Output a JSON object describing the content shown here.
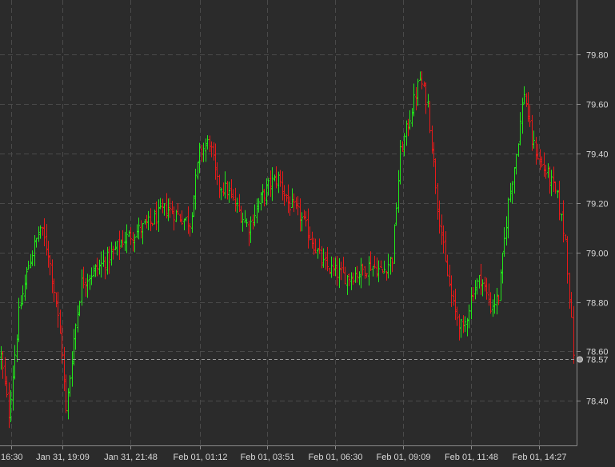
{
  "chart_data": {
    "type": "ohlc",
    "title": "",
    "xlabel": "",
    "ylabel": "",
    "ylim": [
      78.22,
      80.02
    ],
    "y_ticks": [
      78.4,
      78.6,
      78.8,
      79.0,
      79.2,
      79.4,
      79.6,
      79.8
    ],
    "y_tick_labels": [
      "78.40",
      "78.60",
      "78.80",
      "79.00",
      "79.20",
      "79.40",
      "79.60",
      "79.80"
    ],
    "x_tick_labels": [
      "16:30",
      "Jan 31, 19:09",
      "Jan 31, 21:48",
      "Feb 01, 01:12",
      "Feb 01, 03:51",
      "Feb 01, 06:30",
      "Feb 01, 09:09",
      "Feb 01, 11:48",
      "Feb 01, 14:27"
    ],
    "current_price": 78.57,
    "current_price_label": "78.57",
    "grid": true,
    "colors": {
      "background": "#2b2b2b",
      "up": "#22e81a",
      "down": "#e81a1a",
      "grid": "#4a4a4a",
      "axis_text": "#d8d8d8",
      "current_line": "#9a9a9a"
    },
    "series": [
      {
        "anchors": [
          {
            "i": 0,
            "v": 78.58
          },
          {
            "i": 4,
            "v": 78.35
          },
          {
            "i": 9,
            "v": 78.75
          },
          {
            "i": 14,
            "v": 78.95
          },
          {
            "i": 20,
            "v": 79.1
          },
          {
            "i": 24,
            "v": 79.0
          },
          {
            "i": 28,
            "v": 78.8
          },
          {
            "i": 31,
            "v": 78.6
          },
          {
            "i": 33,
            "v": 78.35
          },
          {
            "i": 37,
            "v": 78.65
          },
          {
            "i": 41,
            "v": 78.88
          },
          {
            "i": 48,
            "v": 78.93
          },
          {
            "i": 55,
            "v": 78.98
          },
          {
            "i": 62,
            "v": 79.05
          },
          {
            "i": 68,
            "v": 79.08
          },
          {
            "i": 76,
            "v": 79.12
          },
          {
            "i": 84,
            "v": 79.18
          },
          {
            "i": 90,
            "v": 79.15
          },
          {
            "i": 96,
            "v": 79.12
          },
          {
            "i": 101,
            "v": 79.4
          },
          {
            "i": 106,
            "v": 79.45
          },
          {
            "i": 110,
            "v": 79.28
          },
          {
            "i": 115,
            "v": 79.25
          },
          {
            "i": 120,
            "v": 79.18
          },
          {
            "i": 126,
            "v": 79.1
          },
          {
            "i": 131,
            "v": 79.2
          },
          {
            "i": 137,
            "v": 79.28
          },
          {
            "i": 141,
            "v": 79.3
          },
          {
            "i": 146,
            "v": 79.2
          },
          {
            "i": 152,
            "v": 79.15
          },
          {
            "i": 158,
            "v": 79.05
          },
          {
            "i": 164,
            "v": 78.95
          },
          {
            "i": 170,
            "v": 78.92
          },
          {
            "i": 176,
            "v": 78.9
          },
          {
            "i": 182,
            "v": 78.92
          },
          {
            "i": 188,
            "v": 78.95
          },
          {
            "i": 194,
            "v": 78.92
          },
          {
            "i": 199,
            "v": 78.98
          },
          {
            "i": 203,
            "v": 79.4
          },
          {
            "i": 208,
            "v": 79.55
          },
          {
            "i": 213,
            "v": 79.7
          },
          {
            "i": 217,
            "v": 79.6
          },
          {
            "i": 222,
            "v": 79.2
          },
          {
            "i": 226,
            "v": 78.95
          },
          {
            "i": 230,
            "v": 78.78
          },
          {
            "i": 235,
            "v": 78.68
          },
          {
            "i": 240,
            "v": 78.85
          },
          {
            "i": 244,
            "v": 78.9
          },
          {
            "i": 249,
            "v": 78.78
          },
          {
            "i": 253,
            "v": 78.82
          },
          {
            "i": 258,
            "v": 79.2
          },
          {
            "i": 262,
            "v": 79.4
          },
          {
            "i": 266,
            "v": 79.65
          },
          {
            "i": 270,
            "v": 79.45
          },
          {
            "i": 275,
            "v": 79.35
          },
          {
            "i": 279,
            "v": 79.3
          },
          {
            "i": 283,
            "v": 79.22
          },
          {
            "i": 287,
            "v": 79.05
          },
          {
            "i": 291,
            "v": 78.6
          }
        ],
        "count": 292
      }
    ]
  }
}
